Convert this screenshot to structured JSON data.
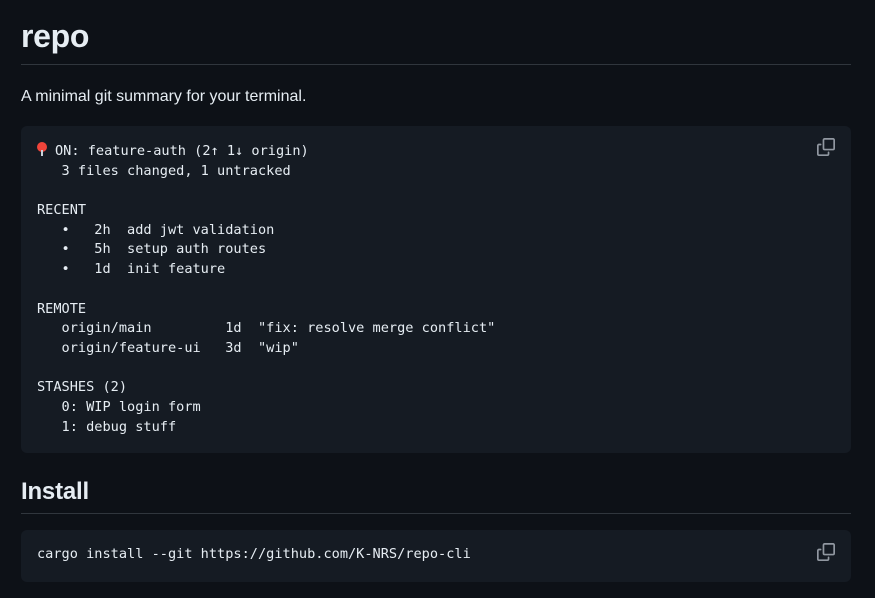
{
  "readme": {
    "title": "repo",
    "description": "A minimal git summary for your terminal.",
    "summary": {
      "status_line": "ON: feature-auth (2↑ 1↓ origin)",
      "changes_line": "   3 files changed, 1 untracked",
      "recent_header": "RECENT",
      "recent": [
        "   •   2h  add jwt validation",
        "   •   5h  setup auth routes",
        "   •   1d  init feature"
      ],
      "remote_header": "REMOTE",
      "remote": [
        "   origin/main         1d  \"fix: resolve merge conflict\"",
        "   origin/feature-ui   3d  \"wip\""
      ],
      "stashes_header": "STASHES (2)",
      "stashes": [
        "   0: WIP login form",
        "   1: debug stuff"
      ]
    },
    "install_heading": "Install",
    "install_command": "cargo install --git https://github.com/K-NRS/repo-cli"
  },
  "icons": {
    "status": "round-pushpin-icon",
    "copy": "copy-icon"
  },
  "colors": {
    "background": "#0d1117",
    "code_background": "#151b23",
    "text": "#e6edf3",
    "divider": "#30363d",
    "icon": "#9198a1",
    "pin": "#f0443a"
  }
}
